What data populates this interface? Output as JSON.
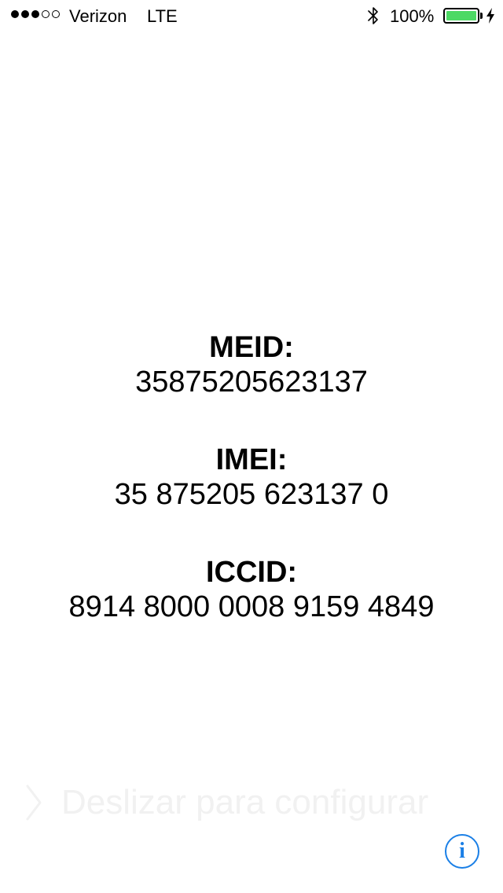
{
  "status_bar": {
    "signal_filled": 3,
    "signal_total": 5,
    "carrier": "Verizon",
    "network": "LTE",
    "bluetooth_icon": "bluetooth-icon",
    "battery_percent_text": "100%",
    "battery_level": 1.0,
    "battery_color": "#4cd964",
    "charging_icon": "bolt-icon"
  },
  "device_info": {
    "meid_label": "MEID:",
    "meid_value": "35875205623137",
    "imei_label": "IMEI:",
    "imei_value": "35 875205 623137 0",
    "iccid_label": "ICCID:",
    "iccid_value": "8914 8000 0008 9159 4849"
  },
  "slide_to_setup": {
    "icon": "chevron-right-icon",
    "text": "Deslizar para configurar"
  },
  "info_button": {
    "icon": "info-icon",
    "glyph": "i",
    "color": "#1a7fe6"
  }
}
